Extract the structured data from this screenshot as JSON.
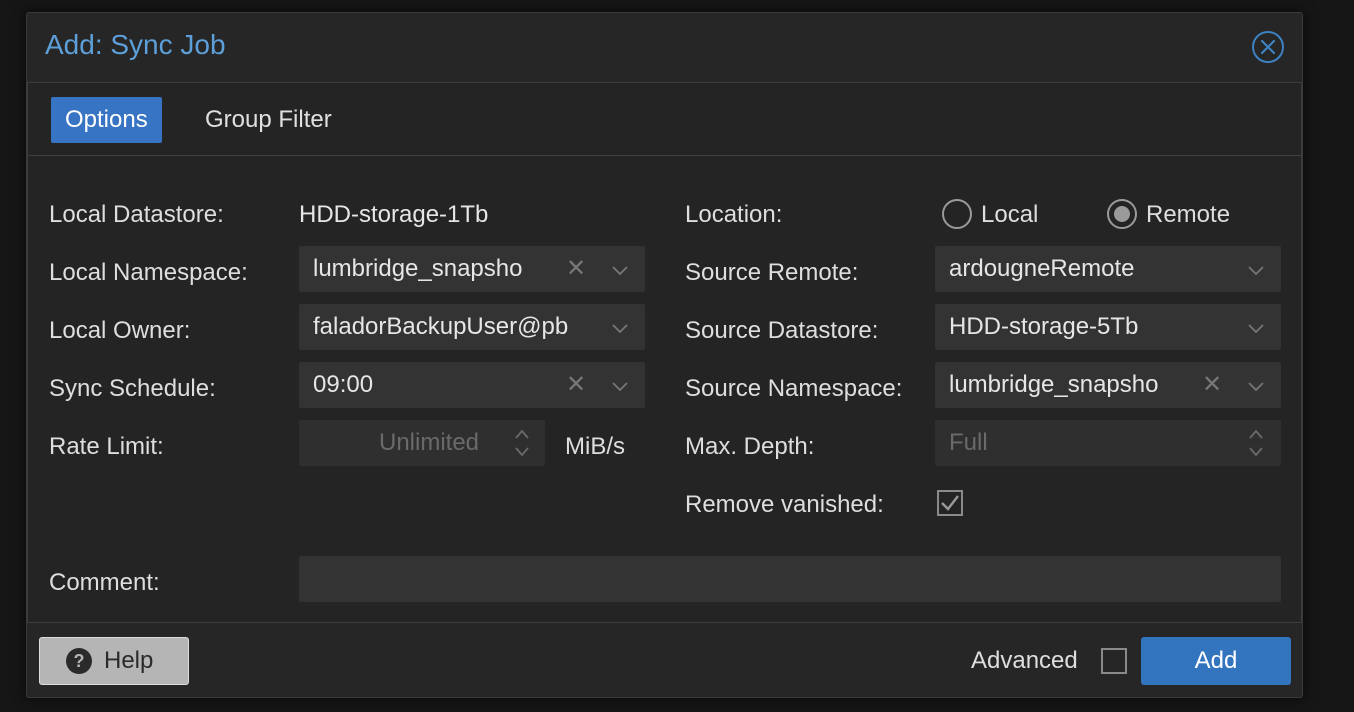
{
  "dialog": {
    "title": "Add: Sync Job",
    "tabs": [
      {
        "label": "Options",
        "active": true
      },
      {
        "label": "Group Filter",
        "active": false
      }
    ]
  },
  "left": {
    "local_datastore": {
      "label": "Local Datastore:",
      "value": "HDD-storage-1Tb"
    },
    "local_namespace": {
      "label": "Local Namespace:",
      "value": "lumbridge_snapsho"
    },
    "local_owner": {
      "label": "Local Owner:",
      "value": "faladorBackupUser@pb"
    },
    "sync_schedule": {
      "label": "Sync Schedule:",
      "value": "09:00"
    },
    "rate_limit": {
      "label": "Rate Limit:",
      "placeholder": "Unlimited",
      "unit": "MiB/s"
    }
  },
  "right": {
    "location": {
      "label": "Location:",
      "options": [
        "Local",
        "Remote"
      ],
      "selected": "Remote"
    },
    "source_remote": {
      "label": "Source Remote:",
      "value": "ardougneRemote"
    },
    "source_datastore": {
      "label": "Source Datastore:",
      "value": "HDD-storage-5Tb"
    },
    "source_namespace": {
      "label": "Source Namespace:",
      "value": "lumbridge_snapsho"
    },
    "max_depth": {
      "label": "Max. Depth:",
      "placeholder": "Full"
    },
    "remove_vanished": {
      "label": "Remove vanished:",
      "checked": true
    }
  },
  "comment": {
    "label": "Comment:",
    "value": ""
  },
  "footer": {
    "help_label": "Help",
    "advanced_label": "Advanced",
    "advanced_checked": false,
    "add_label": "Add"
  },
  "colors": {
    "accent": "#3774c3",
    "title": "#5d9fd8",
    "background": "#262626"
  }
}
